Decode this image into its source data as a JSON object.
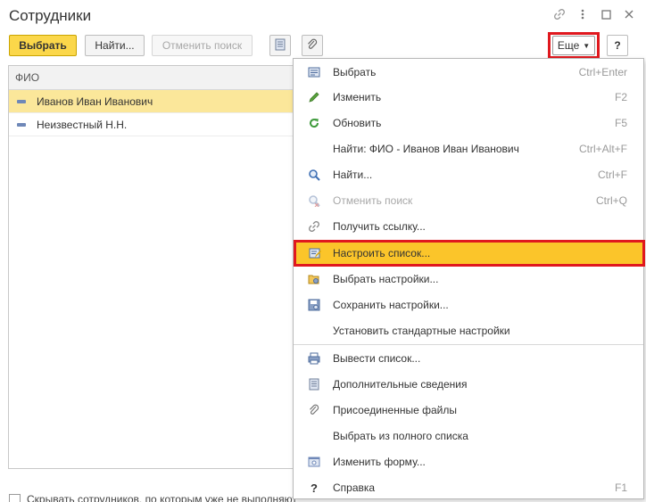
{
  "window": {
    "title": "Сотрудники",
    "icons": [
      "link-icon",
      "more-vertical-icon",
      "maximize-icon",
      "close-icon"
    ]
  },
  "toolbar": {
    "select_label": "Выбрать",
    "find_label": "Найти...",
    "cancel_search_label": "Отменить поиск",
    "more_label": "Еще",
    "help_label": "?"
  },
  "grid": {
    "column_header": "ФИО",
    "rows": [
      "Иванов Иван Иванович",
      "Неизвестный Н.Н."
    ]
  },
  "footer": {
    "checkbox_label": "Скрывать сотрудников, по которым уже не выполняют"
  },
  "menu": {
    "items": [
      {
        "label": "Выбрать",
        "shortcut": "Ctrl+Enter",
        "icon": "select-list-icon"
      },
      {
        "label": "Изменить",
        "shortcut": "F2",
        "icon": "pencil-icon"
      },
      {
        "label": "Обновить",
        "shortcut": "F5",
        "icon": "refresh-icon"
      },
      {
        "label": "Найти: ФИО - Иванов Иван Иванович",
        "shortcut": "Ctrl+Alt+F",
        "icon": ""
      },
      {
        "label": "Найти...",
        "shortcut": "Ctrl+F",
        "icon": "search-icon"
      },
      {
        "label": "Отменить поиск",
        "shortcut": "Ctrl+Q",
        "icon": "cancel-search-icon"
      },
      {
        "label": "Получить ссылку...",
        "shortcut": "",
        "icon": "link-icon"
      },
      {
        "label": "Настроить список...",
        "shortcut": "",
        "icon": "list-settings-icon"
      },
      {
        "label": "Выбрать настройки...",
        "shortcut": "",
        "icon": "choose-settings-icon"
      },
      {
        "label": "Сохранить настройки...",
        "shortcut": "",
        "icon": "save-settings-icon"
      },
      {
        "label": "Установить стандартные настройки",
        "shortcut": "",
        "icon": ""
      },
      {
        "label": "Вывести список...",
        "shortcut": "",
        "icon": "print-list-icon"
      },
      {
        "label": "Дополнительные сведения",
        "shortcut": "",
        "icon": "additional-info-icon"
      },
      {
        "label": "Присоединенные файлы",
        "shortcut": "",
        "icon": "paperclip-icon"
      },
      {
        "label": "Выбрать из полного списка",
        "shortcut": "",
        "icon": ""
      },
      {
        "label": "Изменить форму...",
        "shortcut": "",
        "icon": "form-settings-icon"
      },
      {
        "label": "Справка",
        "shortcut": "F1",
        "icon": "help-icon"
      }
    ]
  },
  "colors": {
    "primary_button": "#fbd74a",
    "selected_row": "#fbe79a",
    "highlighted_menu_item": "#fbc52a",
    "annotation_outline": "#e0181e"
  }
}
